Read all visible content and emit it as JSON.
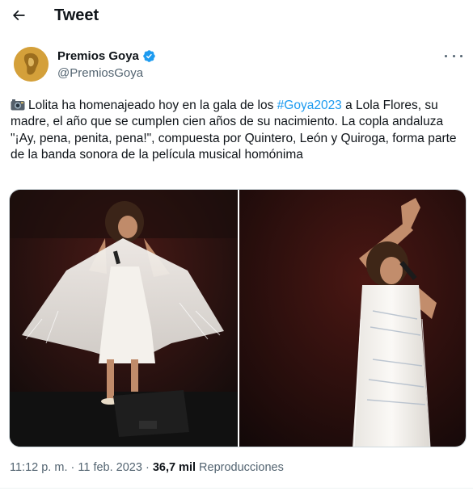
{
  "header": {
    "title": "Tweet"
  },
  "author": {
    "name": "Premios Goya",
    "handle": "@PremiosGoya",
    "verified_color": "#1d9bf0"
  },
  "tweet": {
    "emoji": "camera-flash-icon",
    "text_part1": "Lolita ha homenajeado hoy en la gala de los ",
    "hashtag": "#Goya2023",
    "text_part2": " a Lola Flores, su madre, el año que se cumplen cien años de su nacimiento. La copla andaluza \"¡Ay, pena, penita, pena!\", compuesta por Quintero, León y Quiroga, forma parte de la banda sonora de la película musical homónima"
  },
  "meta": {
    "time": "11:12 p. m.",
    "separator": " · ",
    "date": "11 feb. 2023",
    "views_count": "36,7 mil",
    "views_label": " Reproducciones"
  },
  "colors": {
    "text": "#0f1419",
    "secondary": "#536471",
    "accent": "#1d9bf0"
  }
}
